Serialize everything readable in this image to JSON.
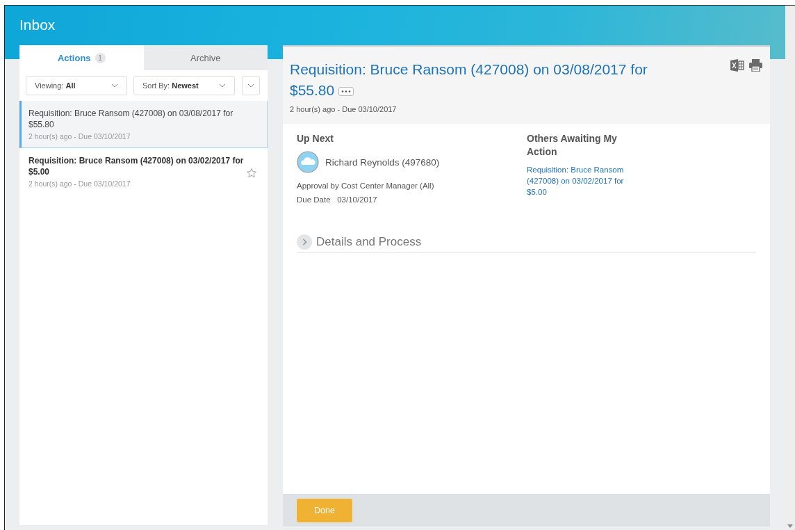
{
  "header": {
    "title": "Inbox"
  },
  "tabs": [
    {
      "label": "Actions",
      "count": "1",
      "selected": true
    },
    {
      "label": "Archive",
      "selected": false
    }
  ],
  "filters": [
    {
      "label": "Viewing:",
      "value": "All"
    },
    {
      "label": "Sort By:",
      "value": "Newest"
    }
  ],
  "items": [
    {
      "title": "Requisition: Bruce Ransom (427008) on 03/08/2017 for $55.80",
      "meta": "2 hour(s) ago - Due 03/10/2017",
      "selected": true,
      "unread": false
    },
    {
      "title": "Requisition: Bruce Ransom (427008) on 03/02/2017 for $5.00",
      "meta": "2 hour(s) ago - Due 03/10/2017",
      "selected": false,
      "unread": true
    }
  ],
  "detail": {
    "title": "Requisition: Bruce Ransom (427008) on 03/08/2017 for $55.80",
    "meta": "2 hour(s) ago - Due 03/10/2017",
    "up_next": {
      "heading": "Up Next",
      "person": "Richard Reynolds (497680)",
      "step": "Approval by Cost Center Manager (All)",
      "due_label": "Due Date",
      "due_value": "03/10/2017"
    },
    "others": {
      "heading": "Others Awaiting My Action",
      "links": [
        "Requisition: Bruce Ransom (427008) on 03/02/2017 for $5.00"
      ]
    },
    "section": {
      "label": "Details and Process",
      "expanded": false
    },
    "button": "Done"
  }
}
